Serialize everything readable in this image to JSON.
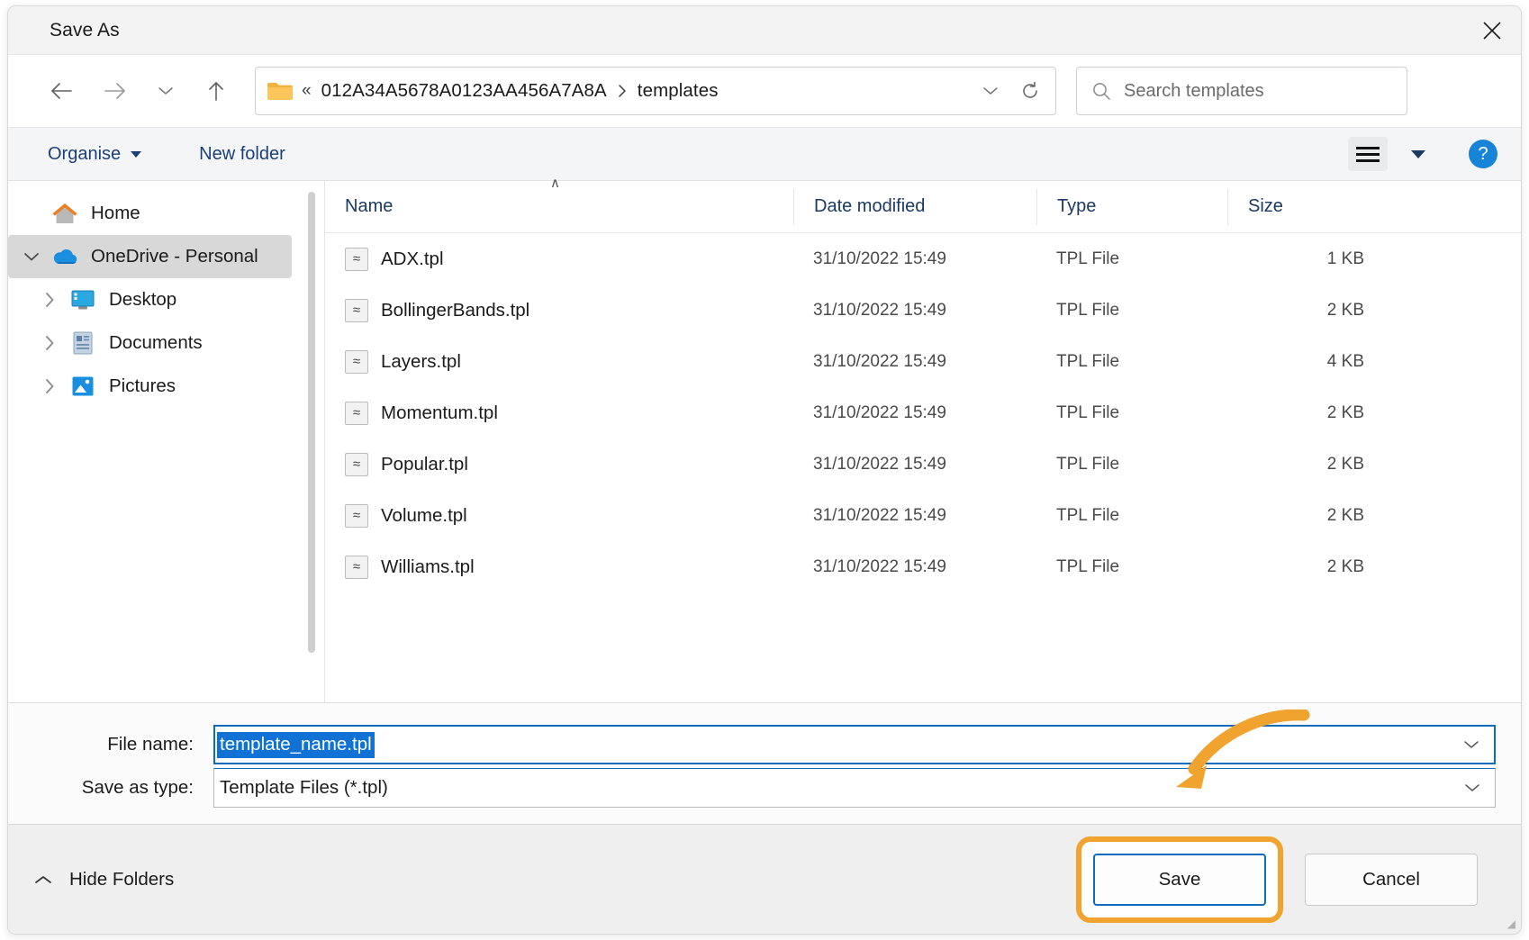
{
  "window": {
    "title": "Save As",
    "close_label": "✕"
  },
  "nav": {
    "back_icon": "back-arrow-icon",
    "forward_icon": "forward-arrow-icon",
    "recent_icon": "chevron-down-icon",
    "up_icon": "up-arrow-icon",
    "address": {
      "folder_icon": "folder-icon",
      "overflow": "«",
      "crumbs": [
        "012A34A5678A0123AA456A7A8A",
        "templates"
      ],
      "separator": "›",
      "dropdown_icon": "chevron-down-icon",
      "refresh_icon": "refresh-icon"
    },
    "search": {
      "icon": "search-icon",
      "placeholder": "Search templates",
      "value": ""
    }
  },
  "command_bar": {
    "organise_label": "Organise",
    "new_folder_label": "New folder",
    "view_icon": "list-view-icon",
    "view_caret_icon": "chevron-down-icon",
    "help_label": "?"
  },
  "sidebar": {
    "items": [
      {
        "label": "Home",
        "icon": "home-icon",
        "chevron": "none",
        "selected": false,
        "indent": 0
      },
      {
        "label": "OneDrive - Personal",
        "icon": "onedrive-cloud-icon",
        "chevron": "expanded",
        "selected": true,
        "indent": 0
      },
      {
        "label": "Desktop",
        "icon": "desktop-icon",
        "chevron": "collapsed",
        "selected": false,
        "indent": 1
      },
      {
        "label": "Documents",
        "icon": "documents-icon",
        "chevron": "collapsed",
        "selected": false,
        "indent": 1
      },
      {
        "label": "Pictures",
        "icon": "pictures-icon",
        "chevron": "collapsed",
        "selected": false,
        "indent": 1
      }
    ]
  },
  "file_list": {
    "columns": [
      "Name",
      "Date modified",
      "Type",
      "Size"
    ],
    "sort_indicator": "∧",
    "sort_column": "Name",
    "rows": [
      {
        "name": "ADX.tpl",
        "date": "31/10/2022 15:49",
        "type": "TPL File",
        "size": "1 KB"
      },
      {
        "name": "BollingerBands.tpl",
        "date": "31/10/2022 15:49",
        "type": "TPL File",
        "size": "2 KB"
      },
      {
        "name": "Layers.tpl",
        "date": "31/10/2022 15:49",
        "type": "TPL File",
        "size": "4 KB"
      },
      {
        "name": "Momentum.tpl",
        "date": "31/10/2022 15:49",
        "type": "TPL File",
        "size": "2 KB"
      },
      {
        "name": "Popular.tpl",
        "date": "31/10/2022 15:49",
        "type": "TPL File",
        "size": "2 KB"
      },
      {
        "name": "Volume.tpl",
        "date": "31/10/2022 15:49",
        "type": "TPL File",
        "size": "2 KB"
      },
      {
        "name": "Williams.tpl",
        "date": "31/10/2022 15:49",
        "type": "TPL File",
        "size": "2 KB"
      }
    ]
  },
  "form": {
    "file_name_label": "File name:",
    "file_name_value": "template_name.tpl",
    "save_as_type_label": "Save as type:",
    "save_as_type_value": "Template Files (*.tpl)"
  },
  "footer": {
    "hide_folders_label": "Hide Folders",
    "save_label": "Save",
    "cancel_label": "Cancel"
  },
  "annotation": {
    "color": "#f0a32e",
    "target": "save-button"
  }
}
